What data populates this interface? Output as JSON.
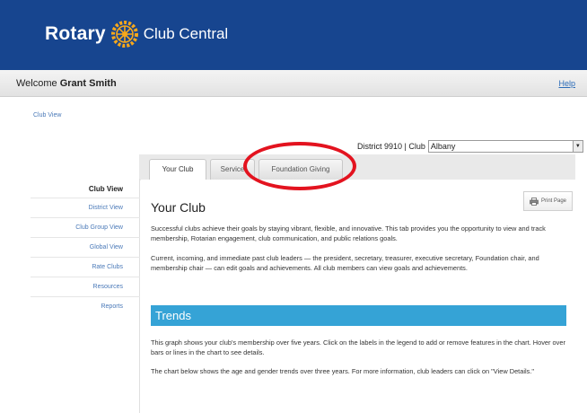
{
  "brand": {
    "name": "Rotary",
    "product": "Club Central",
    "logo_icon": "rotary-wheel-icon"
  },
  "welcome": {
    "prefix": "Welcome",
    "user": "Grant Smith",
    "help": "Help"
  },
  "breadcrumb": "Club View",
  "club_selector": {
    "label": "District 9910 | Club",
    "value": "Albany"
  },
  "tabs": [
    {
      "label": "Your Club",
      "active": true
    },
    {
      "label": "Service",
      "active": false
    },
    {
      "label": "Foundation Giving",
      "active": false
    }
  ],
  "sidebar": {
    "items": [
      {
        "label": "Club View",
        "current": true
      },
      {
        "label": "District View",
        "current": false
      },
      {
        "label": "Club Group View",
        "current": false
      },
      {
        "label": "Global View",
        "current": false
      },
      {
        "label": "Rate Clubs",
        "current": false
      },
      {
        "label": "Resources",
        "current": false
      },
      {
        "label": "Reports",
        "current": false
      }
    ]
  },
  "main": {
    "print": "Print Page",
    "title": "Your Club",
    "intro": "Successful clubs achieve their goals by staying vibrant, flexible, and innovative. This tab provides you the opportunity to view and track membership, Rotarian engagement, club communication, and public relations goals.",
    "leaders": "Current, incoming, and immediate past club leaders — the president, secretary, treasurer, executive secretary, Foundation chair, and membership chair — can edit goals and achievements. All club members can view goals and achievements.",
    "trends_title": "Trends",
    "trends_p1": "This graph shows your club's membership over five years. Click on the labels in the legend to add or remove features in the chart. Hover over bars or lines in the chart to see details.",
    "trends_p2": "The chart below shows the age and gender trends over three years. For more information, club leaders can click on \"View Details.\""
  },
  "colors": {
    "brand_blue": "#17458f",
    "trends_blue": "#35a3d6",
    "highlight_red": "#e3131f",
    "link_blue": "#4a79b8"
  }
}
